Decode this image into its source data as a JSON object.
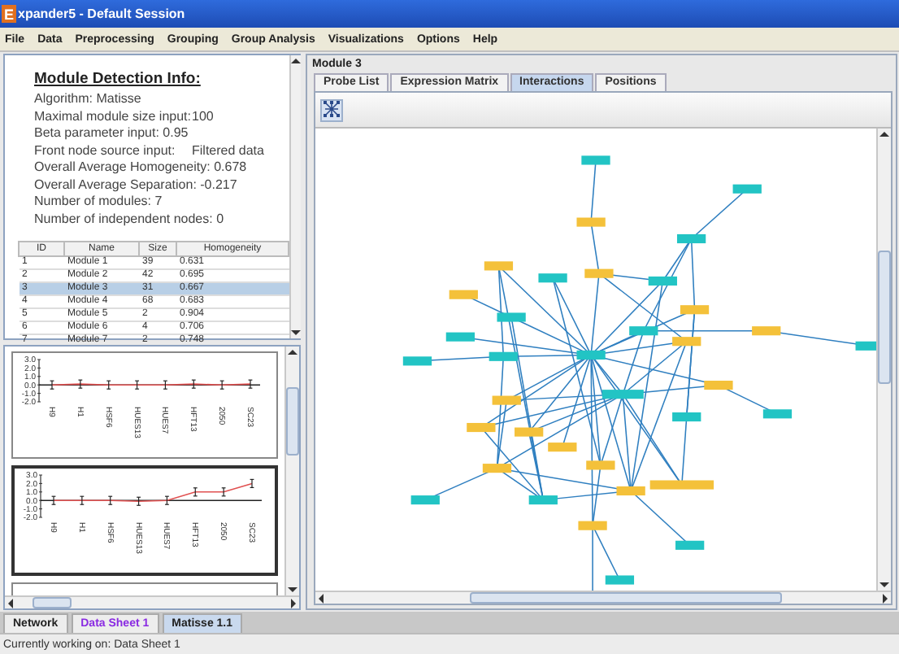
{
  "window": {
    "app_icon": "E",
    "title": "xpander5 - Default Session"
  },
  "menu": [
    "File",
    "Data",
    "Preprocessing",
    "Grouping",
    "Group Analysis",
    "Visualizations",
    "Options",
    "Help"
  ],
  "info": {
    "heading": "Module Detection Info:",
    "lines": [
      {
        "kind": "inline",
        "label": "Algorithm:",
        "value": "Matisse"
      },
      {
        "kind": "column",
        "label": "Maximal module size input:",
        "value": "100"
      },
      {
        "kind": "inline",
        "label": "Beta parameter input:",
        "value": "0.95"
      },
      {
        "kind": "column",
        "label": "Front node source input:",
        "value": "Filtered data"
      },
      {
        "kind": "inline",
        "label": "Overall Average Homogeneity:",
        "value": "0.678"
      },
      {
        "kind": "inline",
        "label": "Overall Average Separation:",
        "value": "-0.217"
      },
      {
        "kind": "inline",
        "label": "Number of modules:",
        "value": "7"
      },
      {
        "kind": "inline",
        "label": "Number of independent nodes:",
        "value": "0"
      }
    ]
  },
  "table": {
    "columns": [
      "ID",
      "Name",
      "Size",
      "Homogeneity"
    ],
    "rows": [
      {
        "cells": [
          "1",
          "Module 1",
          "39",
          "0.631"
        ],
        "selected": false
      },
      {
        "cells": [
          "2",
          "Module 2",
          "42",
          "0.695"
        ],
        "selected": false
      },
      {
        "cells": [
          "3",
          "Module 3",
          "31",
          "0.667"
        ],
        "selected": true
      },
      {
        "cells": [
          "4",
          "Module 4",
          "68",
          "0.683"
        ],
        "selected": false
      },
      {
        "cells": [
          "5",
          "Module 5",
          "2",
          "0.904"
        ],
        "selected": false
      },
      {
        "cells": [
          "6",
          "Module 6",
          "4",
          "0.706"
        ],
        "selected": false
      },
      {
        "cells": [
          "7",
          "Module 7",
          "2",
          "0.748"
        ],
        "selected": false
      }
    ]
  },
  "profiles": [
    {
      "selected": false,
      "chart_data": {
        "type": "line",
        "categories": [
          "H9",
          "H1",
          "HSF6",
          "HUES13",
          "HUES7",
          "HFT13",
          "2050",
          "SC23"
        ],
        "yticks": [
          {
            "value": 3,
            "label": "3.0"
          },
          {
            "value": 2,
            "label": "2.0"
          },
          {
            "value": 1,
            "label": "1.0"
          },
          {
            "value": 0,
            "label": "0.0"
          },
          {
            "value": -1,
            "label": "-1.0"
          },
          {
            "value": -2,
            "label": "-2.0"
          }
        ],
        "ylim": [
          -2,
          3
        ],
        "series": [
          {
            "color": "#e05050",
            "values": [
              0,
              0.1,
              0,
              0,
              0,
              0.1,
              0,
              0.1
            ]
          }
        ]
      }
    },
    {
      "selected": true,
      "chart_data": {
        "type": "line",
        "categories": [
          "H9",
          "H1",
          "HSF6",
          "HUES13",
          "HUES7",
          "HFT13",
          "2050",
          "SC23"
        ],
        "yticks": [
          {
            "value": 3,
            "label": "3.0"
          },
          {
            "value": 2,
            "label": "2.0"
          },
          {
            "value": 1,
            "label": "1.0"
          },
          {
            "value": 0,
            "label": "0.0"
          },
          {
            "value": -1,
            "label": "-1.0"
          },
          {
            "value": -2,
            "label": "-2.0"
          }
        ],
        "ylim": [
          -2,
          3
        ],
        "series": [
          {
            "color": "#e05050",
            "values": [
              0,
              0,
              0,
              -0.1,
              0,
              1,
              1,
              2
            ]
          }
        ]
      }
    }
  ],
  "module_panel": {
    "title": "Module 3",
    "tabs": [
      {
        "label": "Probe List",
        "selected": false
      },
      {
        "label": "Expression Matrix",
        "selected": false
      },
      {
        "label": "Interactions",
        "selected": true
      },
      {
        "label": "Positions",
        "selected": false
      }
    ]
  },
  "bottom_tabs": [
    {
      "label": "Network",
      "selected": false,
      "color": "#222222"
    },
    {
      "label": "Data Sheet 1",
      "selected": false,
      "color": "#8a2be2"
    },
    {
      "label": "Matisse 1.1",
      "selected": true,
      "color": "#222222"
    }
  ],
  "status_bar": "Currently working on: Data Sheet 1"
}
